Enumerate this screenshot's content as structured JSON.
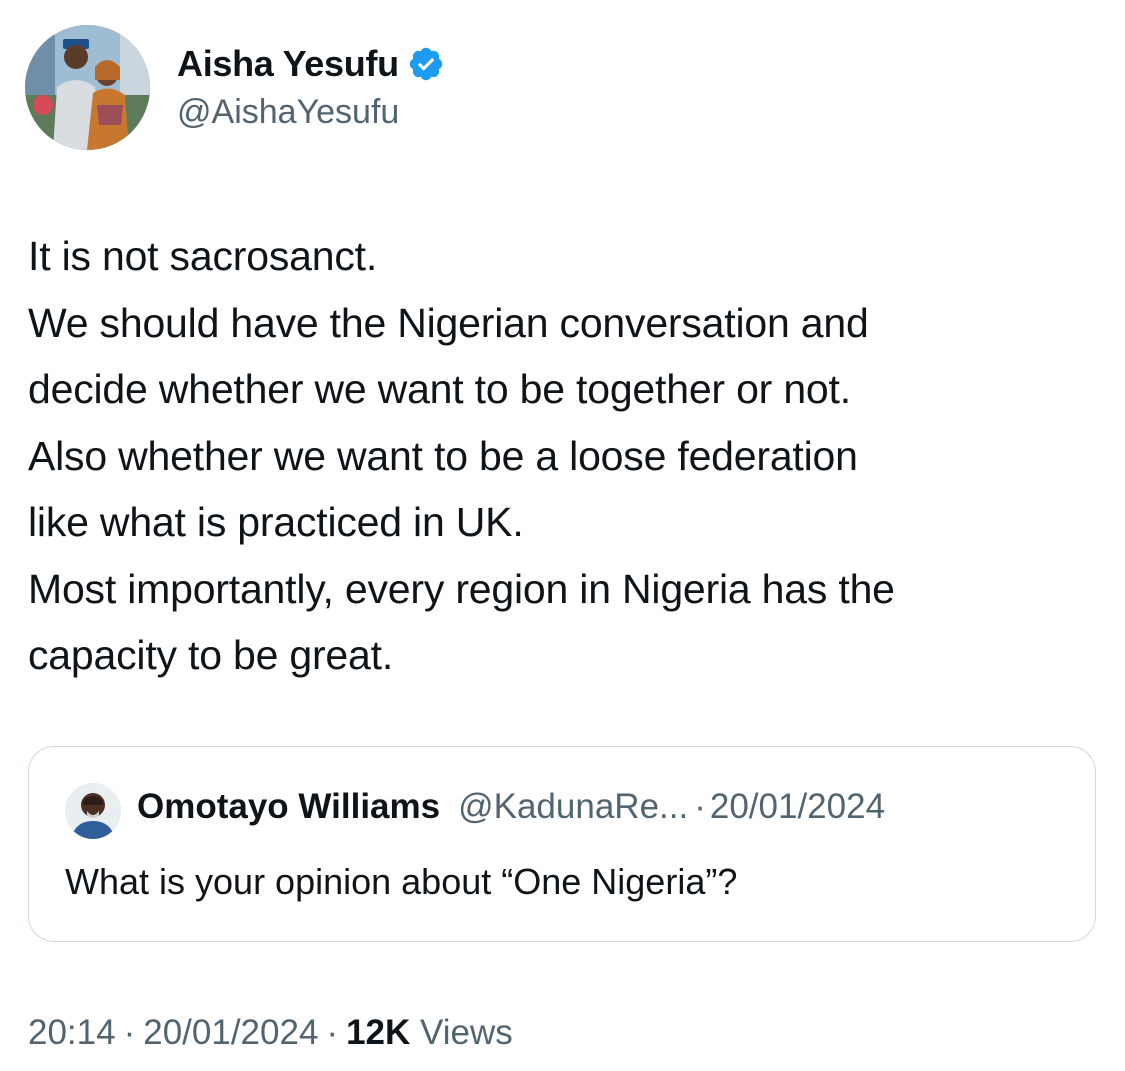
{
  "author": {
    "display_name": "Aisha Yesufu",
    "handle": "@AishaYesufu",
    "verified_color": "#1d9bf0",
    "avatar_icon": "profile-photo"
  },
  "tweet": {
    "lines": [
      "It is not sacrosanct.",
      "We should have the Nigerian conversation and",
      "decide whether we want to be together or not.",
      "Also whether we want to be a loose federation",
      "like what is practiced in UK.",
      "Most importantly, every region in Nigeria has the",
      "capacity to be great."
    ]
  },
  "quoted_tweet": {
    "display_name": "Omotayo Williams",
    "handle": "@KadunaRe...",
    "separator": "·",
    "date": "20/01/2024",
    "text": "What is your opinion about  “One Nigeria”?"
  },
  "footer": {
    "time": "20:14",
    "separator": "·",
    "date": "20/01/2024",
    "views_count": "12K",
    "views_label": "Views"
  },
  "colors": {
    "text_primary": "#0f1419",
    "text_secondary": "#536471",
    "border": "#cfd9de"
  }
}
